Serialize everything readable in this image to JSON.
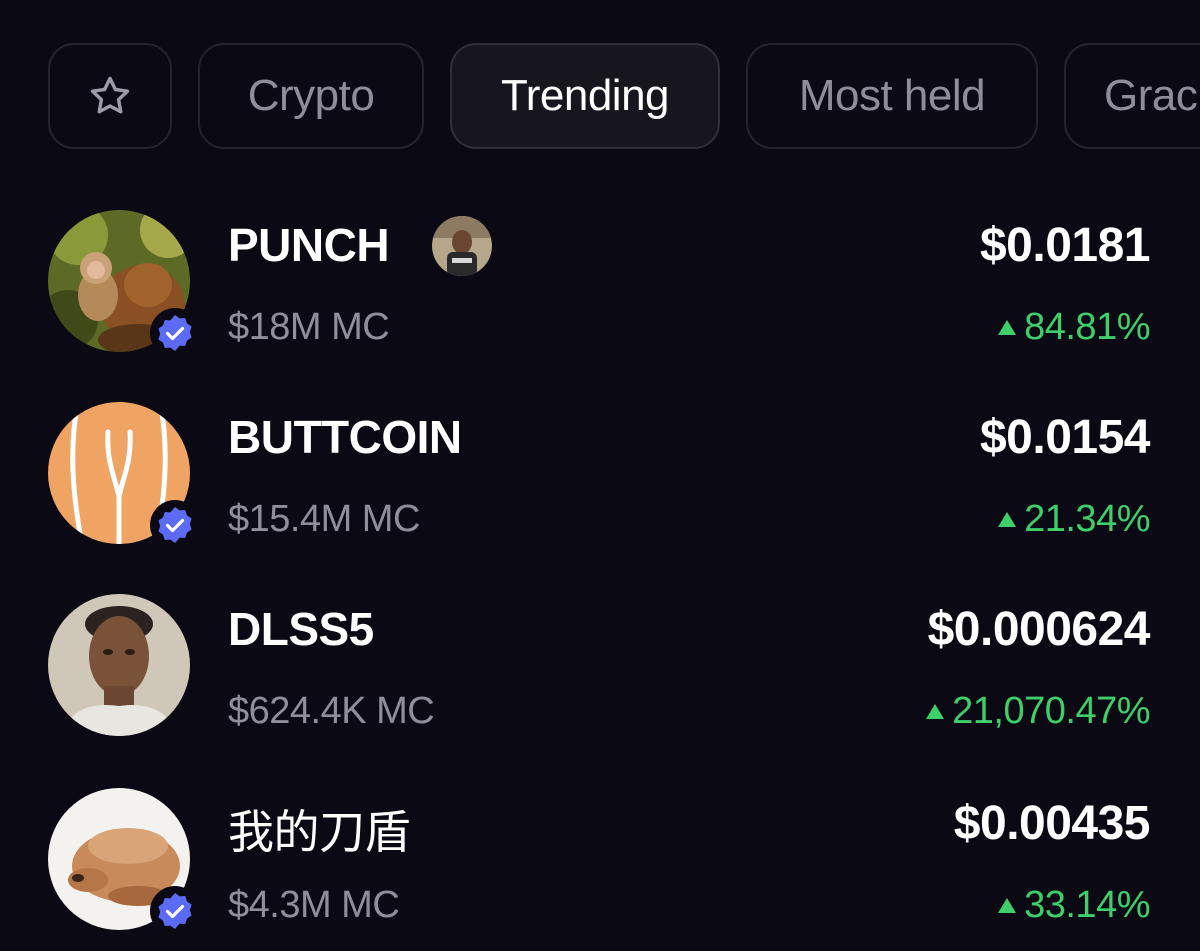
{
  "tabs": {
    "star_icon": "star-icon",
    "items": [
      {
        "label": "Crypto",
        "active": false
      },
      {
        "label": "Trending",
        "active": true
      },
      {
        "label": "Most held",
        "active": false
      },
      {
        "label": "Grac",
        "active": false
      }
    ]
  },
  "tokens": [
    {
      "name": "PUNCH",
      "market_cap": "$18M MC",
      "price": "$0.0181",
      "change": "84.81%",
      "verified": true
    },
    {
      "name": "BUTTCOIN",
      "market_cap": "$15.4M MC",
      "price": "$0.0154",
      "change": "21.34%",
      "verified": true
    },
    {
      "name": "DLSS5",
      "market_cap": "$624.4K MC",
      "price": "$0.000624",
      "change": "21,070.47%",
      "verified": false
    },
    {
      "name": "我的刀盾",
      "market_cap": "$4.3M MC",
      "price": "$0.00435",
      "change": "33.14%",
      "verified": true
    }
  ],
  "colors": {
    "background": "#0b0a14",
    "positive": "#3fcf6a",
    "verified": "#5b6bf5",
    "muted_text": "#8f8e9b"
  }
}
